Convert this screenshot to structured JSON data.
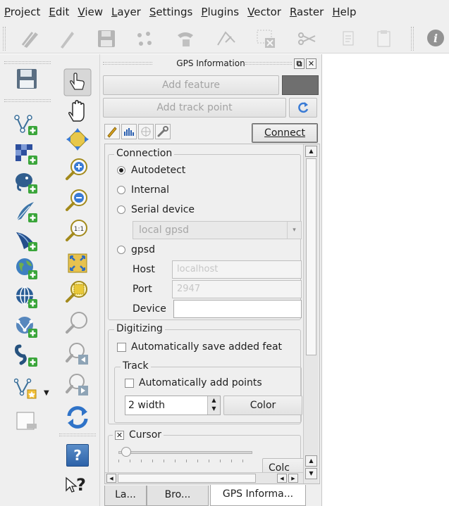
{
  "menu": [
    "Project",
    "Edit",
    "View",
    "Layer",
    "Settings",
    "Plugins",
    "Vector",
    "Raster",
    "Help"
  ],
  "dock": {
    "title": "GPS Information",
    "add_feature": "Add feature",
    "add_track_point": "Add track point",
    "connect": "Connect",
    "connection": {
      "title": "Connection",
      "options": [
        "Autodetect",
        "Internal",
        "Serial device",
        "gpsd"
      ],
      "selected": "Autodetect",
      "serial_device_value": "local gpsd",
      "host_label": "Host",
      "host_placeholder": "localhost",
      "port_label": "Port",
      "port_placeholder": "2947",
      "device_label": "Device",
      "device_value": ""
    },
    "digitizing": {
      "title": "Digitizing",
      "auto_save_label": "Automatically save added feat",
      "track": {
        "title": "Track",
        "auto_add_label": "Automatically add points",
        "width_value": "2 width",
        "color_label": "Color"
      }
    },
    "cursor": {
      "title": "Cursor",
      "checked": true,
      "color_label": "Colc"
    },
    "tabs": [
      "La...",
      "Bro...",
      "GPS Informa..."
    ],
    "active_tab": "GPS Informa..."
  },
  "left_toolbar_help": "?",
  "whatsthis": "?",
  "colors": {
    "panel_bg": "#efefef",
    "track_color_swatch": "#6f6f6f",
    "accent_blue": "#3a7bd5"
  }
}
